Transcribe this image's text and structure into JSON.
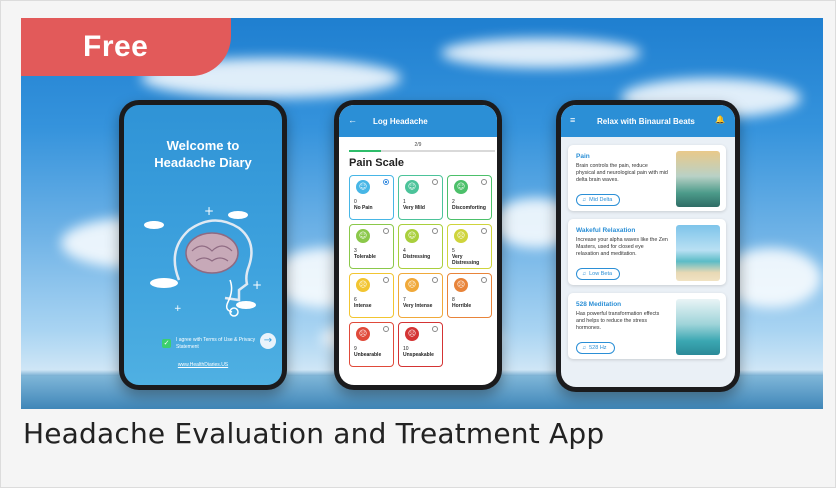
{
  "badge": {
    "label": "Free",
    "color": "#e25a5a"
  },
  "caption": "Headache Evaluation and Treatment App",
  "welcome_screen": {
    "title_line1": "Welcome to",
    "title_line2": "Headache Diary",
    "agree_text": "I agree with Terms of Use & Privacy Statement",
    "next_icon": "arrow-right-icon",
    "website": "www.HealthDiaries.US"
  },
  "log_screen": {
    "back_icon": "arrow-left-icon",
    "title": "Log Headache",
    "step": "2/9",
    "progress": 0.22,
    "section_title": "Pain Scale",
    "options": [
      {
        "num": "0",
        "label": "No Pain",
        "color": "#47b6e6",
        "selected": true
      },
      {
        "num": "1",
        "label": "Very Mild",
        "color": "#4cc39a",
        "selected": false
      },
      {
        "num": "2",
        "label": "Discomforting",
        "color": "#4cc06a",
        "selected": false
      },
      {
        "num": "3",
        "label": "Tolerable",
        "color": "#8bc84a",
        "selected": false
      },
      {
        "num": "4",
        "label": "Distressing",
        "color": "#a9cf3d",
        "selected": false
      },
      {
        "num": "5",
        "label": "Very Distressing",
        "color": "#cfd43c",
        "selected": false
      },
      {
        "num": "6",
        "label": "Intense",
        "color": "#f2c531",
        "selected": false
      },
      {
        "num": "7",
        "label": "Very Intense",
        "color": "#f0a93a",
        "selected": false
      },
      {
        "num": "8",
        "label": "Horrible",
        "color": "#e8843a",
        "selected": false
      },
      {
        "num": "9",
        "label": "Unbearable",
        "color": "#e04a3a",
        "selected": false
      },
      {
        "num": "10",
        "label": "Unspeakable",
        "color": "#d43434",
        "selected": false
      }
    ]
  },
  "binaural_screen": {
    "menu_icon": "hamburger-icon",
    "title": "Relax with Binaural Beats",
    "bell_icon": "bell-icon",
    "tracks": [
      {
        "title": "Pain",
        "desc": "Brain controls the pain, reduce physical and neurological pain with mid delta brain waves.",
        "chip": "Mid Delta"
      },
      {
        "title": "Wakeful Relaxation",
        "desc": "Increase your alpha waves like the Zen Masters, used for closed eye relaxation and meditation.",
        "chip": "Low Beta"
      },
      {
        "title": "528 Meditation",
        "desc": "Has powerful transformation effects and helps to reduce the stress hormones.",
        "chip": "528 Hz"
      }
    ]
  }
}
